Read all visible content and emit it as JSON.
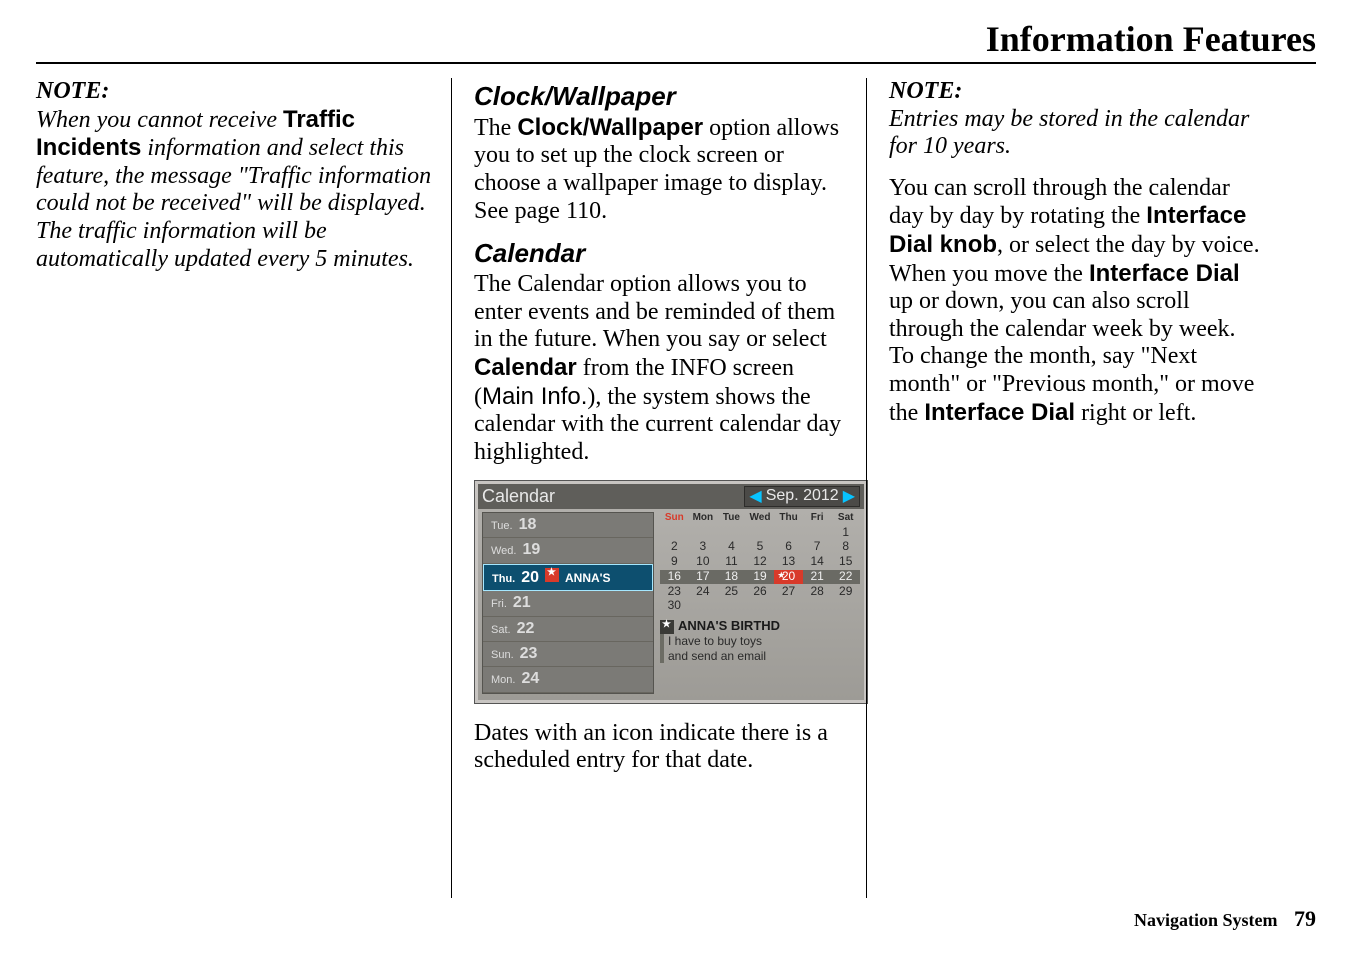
{
  "header": {
    "title": "Information Features"
  },
  "col1": {
    "note_label": "NOTE:",
    "note_p1a": "When you cannot receive ",
    "note_p1_bold": "Traffic Incidents",
    "note_p1b": " information and select this feature, the message \"Traffic information could not be received\" will be displayed. The traffic information will be automatically updated every 5 minutes."
  },
  "col2": {
    "h1": "Clock/Wallpaper",
    "p1a": "The ",
    "p1_bold": "Clock/Wallpaper",
    "p1b": " option allows you to set up the clock screen or choose a wallpaper image to display. See page 110.",
    "h2": "Calendar",
    "p2a": "The Calendar option allows you to enter events and be reminded of them in the future. When you say or select ",
    "p2_bold": "Calendar",
    "p2b": " from the INFO screen (",
    "p2_sans": "Main Info.",
    "p2c": "), the system shows the calendar with the current calendar day highlighted.",
    "caption": "Dates with an icon indicate there is a scheduled entry for that date."
  },
  "calendar": {
    "title": "Calendar",
    "month": "Sep. 2012",
    "day_list": [
      {
        "dow": "Tue.",
        "num": "18",
        "sel": false,
        "event": ""
      },
      {
        "dow": "Wed.",
        "num": "19",
        "sel": false,
        "event": ""
      },
      {
        "dow": "Thu.",
        "num": "20",
        "sel": true,
        "event": "ANNA'S"
      },
      {
        "dow": "Fri.",
        "num": "21",
        "sel": false,
        "event": ""
      },
      {
        "dow": "Sat.",
        "num": "22",
        "sel": false,
        "event": ""
      },
      {
        "dow": "Sun.",
        "num": "23",
        "sel": false,
        "event": ""
      },
      {
        "dow": "Mon.",
        "num": "24",
        "sel": false,
        "event": ""
      }
    ],
    "dow_head": [
      "Sun",
      "Mon",
      "Tue",
      "Wed",
      "Thu",
      "Fri",
      "Sat"
    ],
    "grid": [
      "",
      "",
      "",
      "",
      "",
      "",
      "1",
      "2",
      "3",
      "4",
      "5",
      "6",
      "7",
      "8",
      "9",
      "10",
      "11",
      "12",
      "13",
      "14",
      "15",
      "16",
      "17",
      "18",
      "19",
      "20",
      "21",
      "22",
      "23",
      "24",
      "25",
      "26",
      "27",
      "28",
      "29",
      "30",
      "",
      "",
      "",
      "",
      "",
      ""
    ],
    "highlight_row_start": 21,
    "today_index": 25,
    "event_title": "ANNA'S BIRTHD",
    "event_line1": "I have to buy toys",
    "event_line2": "and send an email"
  },
  "col3": {
    "note_label": "NOTE:",
    "note_body": "Entries may be stored in the calendar for 10 years.",
    "p1a": "You can scroll through the calendar day by day by rotating the ",
    "p1_b1": "Interface Dial knob",
    "p1b": ", or select the day by voice. When you move the ",
    "p1_b2": "Interface Dial",
    "p1c": " up or down, you can also scroll through the calendar week by week. To change the month, say \"Next month\" or \"Previous month,\" or move the ",
    "p1_b3": "Interface Dial",
    "p1d": " right or left."
  },
  "footer": {
    "label": "Navigation System",
    "page": "79"
  }
}
